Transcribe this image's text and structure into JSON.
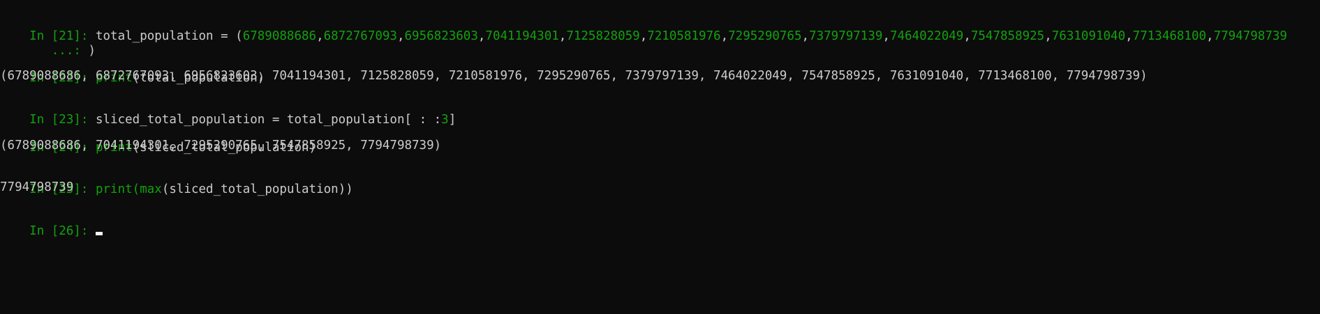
{
  "prompts": {
    "p21": "In [21]: ",
    "p21_cont": "   ...: ",
    "p22": "In [22]: ",
    "p23": "In [23]: ",
    "p24": "In [24]: ",
    "p25": "In [25]: ",
    "p26": "In [26]: "
  },
  "code": {
    "l21_name": "total_population = (",
    "l21_values": [
      "6789088686",
      "6872767093",
      "6956823603",
      "7041194301",
      "7125828059",
      "7210581976",
      "7295290765",
      "7379797139",
      "7464022049",
      "7547858925",
      "7631091040",
      "7713468100",
      "7794798739"
    ],
    "l21_cont": ")",
    "l22_func": "print",
    "l22_arg": "(total_population)",
    "l23_text": "sliced_total_population = total_population[ : :",
    "l23_num": "3",
    "l23_end": "]",
    "l24_func": "print",
    "l24_arg": "(sliced_total_population)",
    "l25_func": "print",
    "l25_paren": "(",
    "l25_func2": "max",
    "l25_arg": "(sliced_total_population))"
  },
  "output": {
    "o22": "(6789088686, 6872767093, 6956823603, 7041194301, 7125828059, 7210581976, 7295290765, 7379797139, 7464022049, 7547858925, 7631091040, 7713468100, 7794798739)",
    "o24": "(6789088686, 7041194301, 7295290765, 7547858925, 7794798739)",
    "o25": "7794798739"
  },
  "colors": {
    "background": "#0c0c0c",
    "text": "#cccccc",
    "prompt_green": "#13a10e"
  }
}
